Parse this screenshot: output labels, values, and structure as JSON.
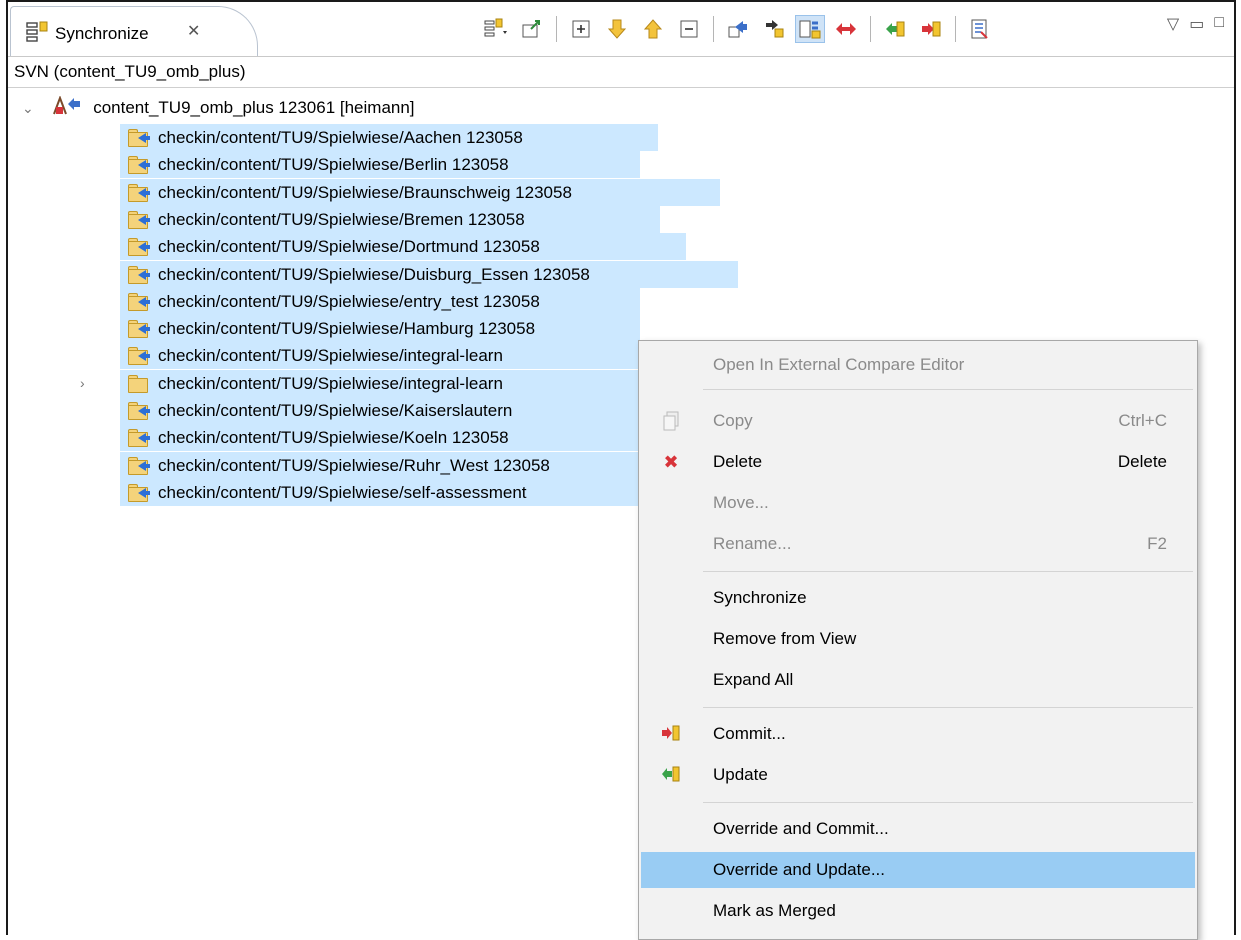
{
  "view": {
    "tab_title": "Synchronize",
    "tab_close_glyph": "✕",
    "breadcrumb": "SVN (content_TU9_omb_plus)"
  },
  "tree": {
    "root": "content_TU9_omb_plus 123061 [heimann]",
    "items": [
      {
        "label": "checkin/content/TU9/Spielwiese/Aachen 123058"
      },
      {
        "label": "checkin/content/TU9/Spielwiese/Berlin 123058"
      },
      {
        "label": "checkin/content/TU9/Spielwiese/Braunschweig 123058"
      },
      {
        "label": "checkin/content/TU9/Spielwiese/Bremen 123058"
      },
      {
        "label": "checkin/content/TU9/Spielwiese/Dortmund 123058"
      },
      {
        "label": "checkin/content/TU9/Spielwiese/Duisburg_Essen 123058"
      },
      {
        "label": "checkin/content/TU9/Spielwiese/entry_test 123058"
      },
      {
        "label": "checkin/content/TU9/Spielwiese/Hamburg 123058"
      },
      {
        "label": "checkin/content/TU9/Spielwiese/integral-learn"
      },
      {
        "label": "checkin/content/TU9/Spielwiese/integral-learn"
      },
      {
        "label": "checkin/content/TU9/Spielwiese/Kaiserslautern"
      },
      {
        "label": "checkin/content/TU9/Spielwiese/Koeln 123058"
      },
      {
        "label": "checkin/content/TU9/Spielwiese/Ruhr_West 123058"
      },
      {
        "label": "checkin/content/TU9/Spielwiese/self-assessment"
      }
    ]
  },
  "context_menu": {
    "open_external": "Open In External Compare Editor",
    "copy": "Copy",
    "copy_shortcut": "Ctrl+C",
    "delete": "Delete",
    "delete_shortcut": "Delete",
    "move": "Move...",
    "rename": "Rename...",
    "rename_shortcut": "F2",
    "synchronize": "Synchronize",
    "remove_from_view": "Remove from View",
    "expand_all": "Expand All",
    "commit": "Commit...",
    "update": "Update",
    "override_commit": "Override and Commit...",
    "override_update": "Override and Update...",
    "mark_merged": "Mark as Merged"
  },
  "colors": {
    "selection": "#cce8ff",
    "menu_highlight": "#99ccf3",
    "menu_bg": "#f2f2f2"
  }
}
